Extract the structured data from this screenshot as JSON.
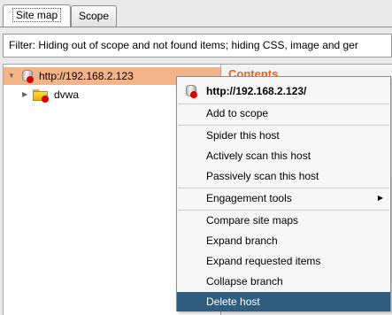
{
  "tabs": [
    {
      "label": "Site map",
      "active": true
    },
    {
      "label": "Scope",
      "active": false
    }
  ],
  "filter": {
    "text": "Filter: Hiding out of scope and not found items;  hiding CSS, image and ger"
  },
  "tree": {
    "items": [
      {
        "label": "http://192.168.2.123",
        "selected": true,
        "icon": "host-icon"
      },
      {
        "label": "dvwa",
        "selected": false,
        "icon": "folder-icon"
      }
    ]
  },
  "contents": {
    "label": "Contents"
  },
  "context_menu": {
    "header": "http://192.168.2.123/",
    "items": [
      {
        "label": "Add to scope"
      },
      {
        "label": "Spider this host"
      },
      {
        "label": "Actively scan this host"
      },
      {
        "label": "Passively scan this host"
      },
      {
        "label": "Engagement tools",
        "submenu": true
      },
      {
        "label": "Compare site maps"
      },
      {
        "label": "Expand branch"
      },
      {
        "label": "Expand requested items"
      },
      {
        "label": "Collapse branch"
      },
      {
        "label": "Delete host",
        "highlighted": true
      }
    ]
  },
  "colors": {
    "selection": "#f4b48a",
    "highlight": "#2f5d80",
    "accent": "#e6651b",
    "status_dot": "#d90000"
  }
}
